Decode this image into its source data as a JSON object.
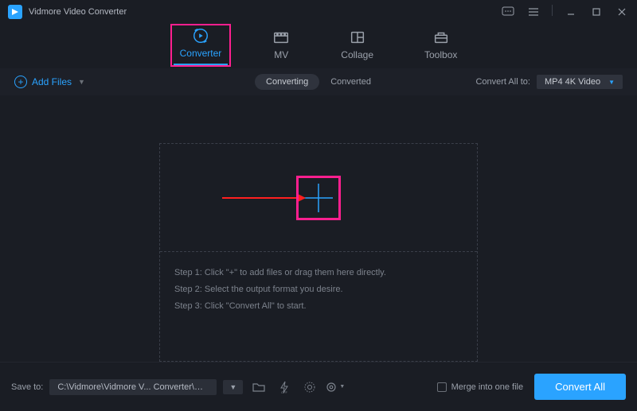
{
  "app": {
    "title": "Vidmore Video Converter"
  },
  "tabs": {
    "converter": "Converter",
    "mv": "MV",
    "collage": "Collage",
    "toolbox": "Toolbox"
  },
  "toolbar": {
    "add_files": "Add Files",
    "converting": "Converting",
    "converted": "Converted",
    "convert_all_to": "Convert All to:",
    "format": "MP4 4K Video"
  },
  "steps": {
    "s1": "Step 1: Click \"+\" to add files or drag them here directly.",
    "s2": "Step 2: Select the output format you desire.",
    "s3": "Step 3: Click \"Convert All\" to start."
  },
  "bottom": {
    "save_to": "Save to:",
    "path": "C:\\Vidmore\\Vidmore V... Converter\\Converted",
    "merge": "Merge into one file",
    "convert_all": "Convert All"
  }
}
